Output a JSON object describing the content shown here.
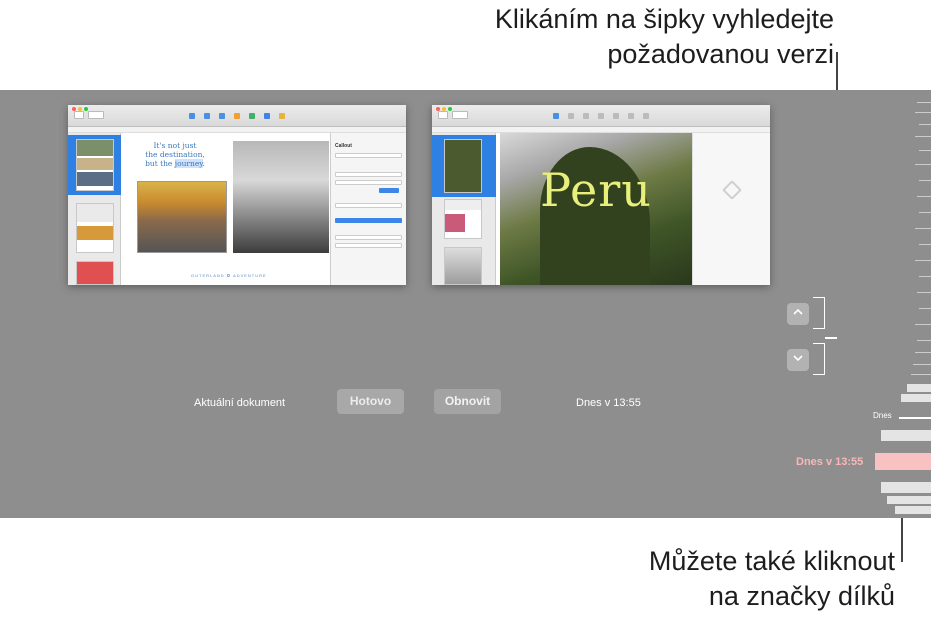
{
  "callouts": {
    "top_line1": "Klikáním na šipky vyhledejte",
    "top_line2": "požadovanou verzi",
    "bottom_line1": "Můžete také kliknout",
    "bottom_line2": "na značky dílků"
  },
  "current_document": {
    "label": "Aktuální dokument",
    "done_button": "Hotovo",
    "quote_line1": "It's not just",
    "quote_line2": "the destination,",
    "quote_line3_pre": "but the ",
    "quote_line3_hl": "journey",
    "quote_line3_post": ".",
    "inspector_title": "Callout",
    "footer_brand": "OUTERLAND ✪ ADVENTURE"
  },
  "version_document": {
    "restore_button": "Obnovit",
    "version_label": "Dnes v 13:55",
    "hero_title": "Peru"
  },
  "timeline": {
    "today_label": "Dnes",
    "selected_label": "Dnes v 13:55"
  },
  "colors": {
    "stage_bg": "#8e8e8e",
    "selected_tick": "#f8c1c2",
    "selected_label": "#f9b7b8",
    "sidebar_selection": "#2f80e3"
  },
  "icons": {
    "up": "chevron-up-icon",
    "down": "chevron-down-icon"
  }
}
